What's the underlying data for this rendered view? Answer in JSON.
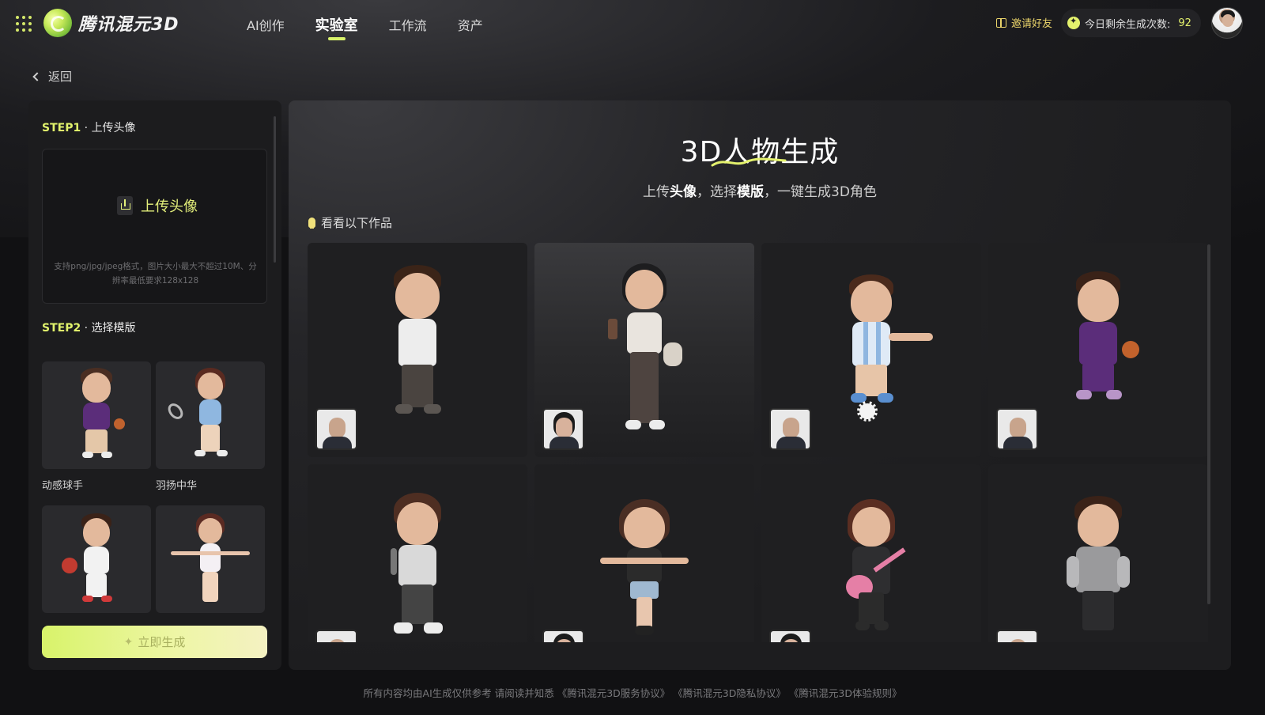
{
  "header": {
    "brand": "腾讯混元3D",
    "nav": [
      {
        "label": "AI创作",
        "active": false
      },
      {
        "label": "实验室",
        "active": true
      },
      {
        "label": "工作流",
        "active": false
      },
      {
        "label": "资产",
        "active": false
      }
    ],
    "invite_label": "邀请好友",
    "quota_label": "今日剩余生成次数:",
    "quota_value": "92"
  },
  "back_label": "返回",
  "left_panel": {
    "step1": {
      "no": "STEP1",
      "title": "上传头像"
    },
    "upload": {
      "button_label": "上传头像",
      "hint": "支持png/jpg/jpeg格式，图片大小最大不超过10M、分辨率最低要求128x128"
    },
    "step2": {
      "no": "STEP2",
      "title": "选择模版"
    },
    "templates": [
      {
        "label": "动感球手",
        "icon": "basketball-player"
      },
      {
        "label": "羽扬中华",
        "icon": "badminton-player"
      },
      {
        "label": "",
        "icon": "table-tennis-player"
      },
      {
        "label": "",
        "icon": "gymnast"
      }
    ],
    "generate_label": "立即生成"
  },
  "main": {
    "title": "3D人物生成",
    "subtitle_parts": [
      "上传",
      "头像",
      "，选择",
      "模版",
      "，一键生成3D角色"
    ],
    "gallery_label": "看看以下作品",
    "gallery": [
      {
        "figure": "boy-white-shirt",
        "thumb": "male"
      },
      {
        "figure": "girl-coffee",
        "thumb": "female"
      },
      {
        "figure": "boy-soccer",
        "thumb": "male"
      },
      {
        "figure": "boy-basketball",
        "thumb": "male"
      },
      {
        "figure": "boy-microphone",
        "thumb": "male"
      },
      {
        "figure": "girl-dancing",
        "thumb": "female"
      },
      {
        "figure": "girl-guitar",
        "thumb": "female"
      },
      {
        "figure": "boy-armor",
        "thumb": "male"
      }
    ]
  },
  "footer": {
    "prefix": "所有内容均由AI生成仅供参考 请阅读并知悉",
    "links": [
      "《腾讯混元3D服务协议》",
      "《腾讯混元3D隐私协议》",
      "《腾讯混元3D体验规则》"
    ]
  },
  "colors": {
    "accent": "#d9f36b",
    "background": "#111113",
    "panel": "#1c1c1e",
    "invite": "#e9d36a"
  }
}
